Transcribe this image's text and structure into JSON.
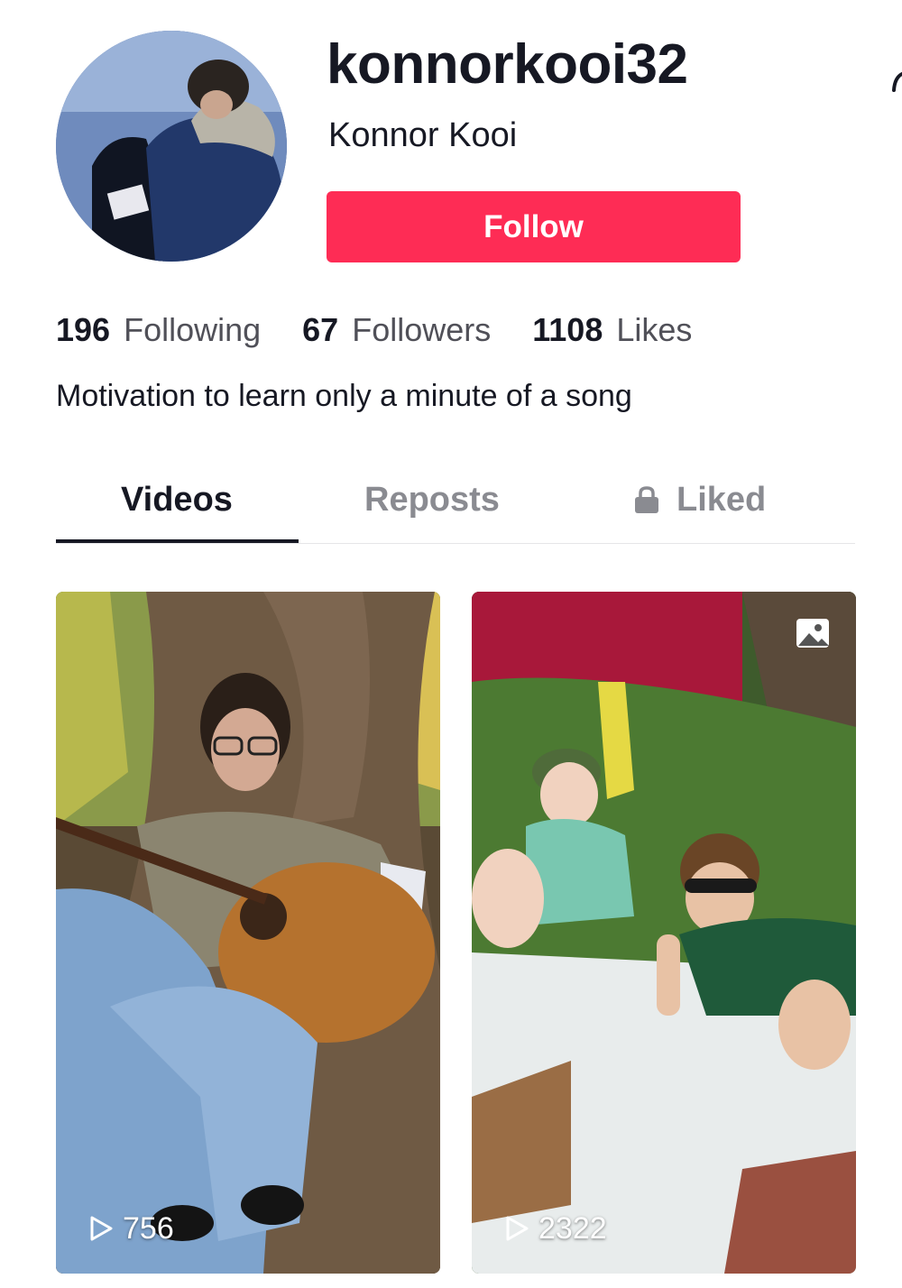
{
  "profile": {
    "username": "konnorkooi32",
    "display_name": "Konnor Kooi",
    "follow_label": "Follow",
    "bio": "Motivation to learn only a minute of a song"
  },
  "stats": [
    {
      "value": "196",
      "label": "Following"
    },
    {
      "value": "67",
      "label": "Followers"
    },
    {
      "value": "1108",
      "label": "Likes"
    }
  ],
  "tabs": [
    {
      "label": "Videos",
      "active": true
    },
    {
      "label": "Reposts",
      "active": false
    },
    {
      "label": "Liked",
      "active": false,
      "icon": "lock-icon"
    }
  ],
  "videos": [
    {
      "views": "756",
      "icon": "play-outline-icon",
      "thumbnail": "person playing acoustic guitar under a tree"
    },
    {
      "views": "2322",
      "icon": "play-outline-icon",
      "badge_icon": "photo-icon",
      "thumbnail": "two kids in a flower garden"
    }
  ],
  "colors": {
    "accent": "#fe2c55",
    "text_primary": "#161823",
    "text_secondary": "#8a8b91"
  }
}
